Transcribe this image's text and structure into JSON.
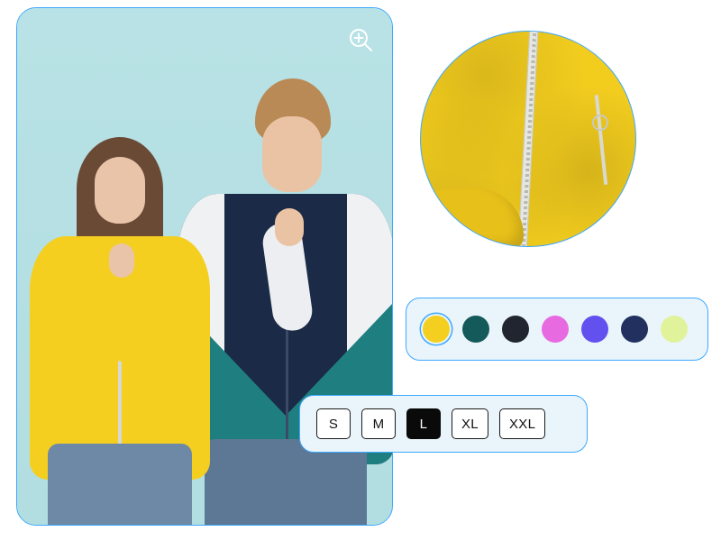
{
  "product_image": {
    "alt": "Two models wearing jackets — woman in yellow zip jacket, man in navy/teal/white colorblock hooded jacket",
    "zoom_icon": "zoom-in"
  },
  "detail_zoom": {
    "alt": "Close-up of yellow jacket zipper and pocket"
  },
  "colors": {
    "options": [
      {
        "name": "yellow",
        "hex": "#f5cf1f",
        "selected": true
      },
      {
        "name": "teal",
        "hex": "#145a5a",
        "selected": false
      },
      {
        "name": "charcoal",
        "hex": "#21252f",
        "selected": false
      },
      {
        "name": "pink",
        "hex": "#e86ae0",
        "selected": false
      },
      {
        "name": "violet",
        "hex": "#6250ef",
        "selected": false
      },
      {
        "name": "navy",
        "hex": "#223060",
        "selected": false
      },
      {
        "name": "lime",
        "hex": "#e0f39a",
        "selected": false
      }
    ]
  },
  "sizes": {
    "options": [
      {
        "label": "S",
        "selected": false
      },
      {
        "label": "M",
        "selected": false
      },
      {
        "label": "L",
        "selected": true
      },
      {
        "label": "XL",
        "selected": false
      },
      {
        "label": "XXL",
        "selected": false
      }
    ]
  }
}
